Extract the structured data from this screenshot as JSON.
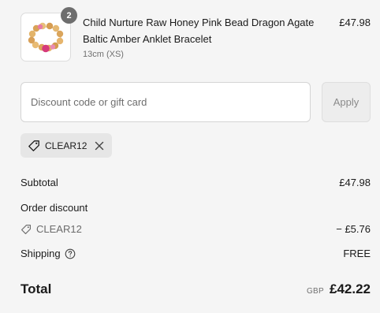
{
  "cart": {
    "item": {
      "quantity": "2",
      "title": "Child Nurture Raw Honey Pink Bead Dragon Agate Baltic Amber Anklet Bracelet",
      "variant": "13cm (XS)",
      "price": "£47.98",
      "image_icon": "bead-bracelet-image"
    }
  },
  "discount": {
    "placeholder": "Discount code or gift card",
    "value": "",
    "apply_label": "Apply",
    "applied_code": "CLEAR12",
    "tag_icon": "tag-icon",
    "remove_icon": "close-icon"
  },
  "summary": {
    "subtotal_label": "Subtotal",
    "subtotal_value": "£47.98",
    "order_discount_label": "Order discount",
    "discount_code": "CLEAR12",
    "discount_value": "− £5.76",
    "shipping_label": "Shipping",
    "shipping_value": "FREE",
    "shipping_help_icon": "question-circle-icon",
    "total_label": "Total",
    "currency": "GBP",
    "total_value": "£42.22"
  },
  "colors": {
    "background": "#f5f5f5",
    "text": "#1a1a1a",
    "muted": "#707070",
    "badge": "#6e6e6e",
    "tag_bg": "#e6e6e6"
  }
}
